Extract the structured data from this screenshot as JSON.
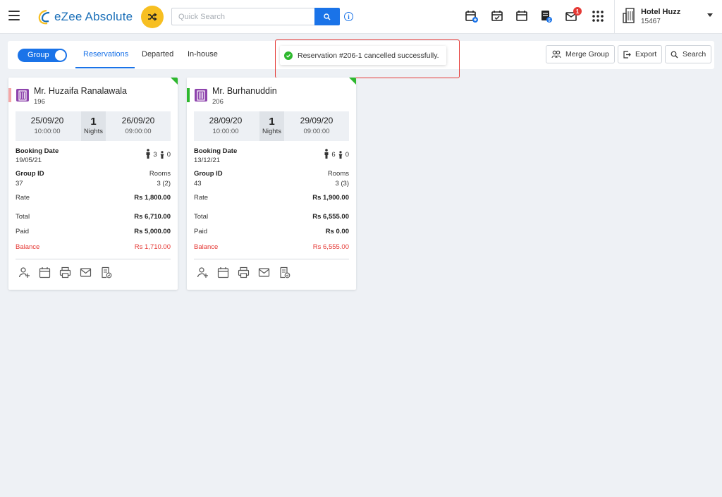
{
  "header": {
    "app_name": "eZee Absolute",
    "search_placeholder": "Quick Search",
    "notification_count": "1",
    "hotel_name": "Hotel Huzz",
    "hotel_code": "15467"
  },
  "subbar": {
    "group_toggle_label": "Group",
    "tabs": [
      "Reservations",
      "Departed",
      "In-house"
    ],
    "active_tab": "Reservations",
    "merge_group_label": "Merge Group",
    "export_label": "Export",
    "search_label": "Search"
  },
  "toast": {
    "message": "Reservation #206-1 cancelled successfully."
  },
  "labels": {
    "nights": "Nights",
    "booking_date": "Booking Date",
    "group_id": "Group ID",
    "rooms": "Rooms",
    "rate": "Rate",
    "total": "Total",
    "paid": "Paid",
    "balance": "Balance"
  },
  "cards": [
    {
      "guest_name": "Mr. Huzaifa Ranalawala",
      "reservation_no": "196",
      "status_color": "#f4a7a7",
      "arrival_date": "25/09/20",
      "arrival_time": "10:00:00",
      "nights": "1",
      "departure_date": "26/09/20",
      "departure_time": "09:00:00",
      "booking_date": "19/05/21",
      "adults": "3",
      "children": "0",
      "group_id": "37",
      "rooms": "3 (2)",
      "rate": "Rs 1,800.00",
      "total": "Rs 6,710.00",
      "paid": "Rs 5,000.00",
      "balance": "Rs 1,710.00"
    },
    {
      "guest_name": "Mr. Burhanuddin",
      "reservation_no": "206",
      "status_color": "#2eb82e",
      "arrival_date": "28/09/20",
      "arrival_time": "10:00:00",
      "nights": "1",
      "departure_date": "29/09/20",
      "departure_time": "09:00:00",
      "booking_date": "13/12/21",
      "adults": "6",
      "children": "0",
      "group_id": "43",
      "rooms": "3 (3)",
      "rate": "Rs 1,900.00",
      "total": "Rs 6,555.00",
      "paid": "Rs 0.00",
      "balance": "Rs 6,555.00"
    }
  ],
  "colors": {
    "primary": "#1a73e8",
    "accent_yellow": "#f7bf21",
    "success": "#2eb82e",
    "danger": "#e53935",
    "page_bg": "#eef1f5"
  }
}
